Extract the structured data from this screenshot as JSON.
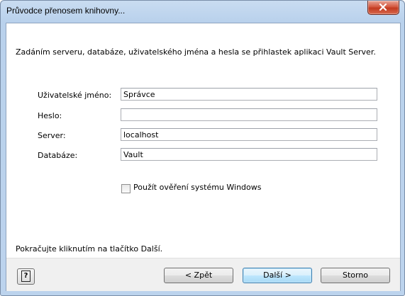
{
  "window": {
    "title": "Průvodce přenosem knihovny..."
  },
  "intro": "Zadáním serveru, databáze, uživatelského jména a hesla se přihlastek aplikaci Vault Server.",
  "fields": {
    "username": {
      "label": "Uživatelské jméno:",
      "value": "Správce"
    },
    "password": {
      "label": "Heslo:",
      "value": ""
    },
    "server": {
      "label": "Server:",
      "value": "localhost"
    },
    "database": {
      "label": "Databáze:",
      "value": "Vault"
    }
  },
  "windows_auth": {
    "label": "Použít ověření systému Windows",
    "checked": false
  },
  "hint": "Pokračujte kliknutím na tlačítko Další.",
  "buttons": {
    "help": "?",
    "back": "< Zpět",
    "next": "Další >",
    "cancel": "Storno"
  },
  "colors": {
    "accent": "#3c7fb1",
    "close": "#c23a20"
  }
}
